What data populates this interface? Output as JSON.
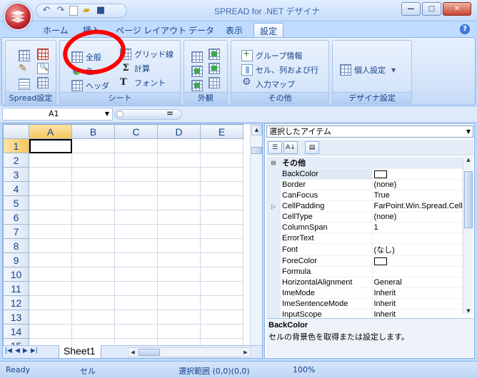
{
  "window": {
    "title": "SPREAD for .NET デザイナ",
    "minimize_label": "—",
    "maximize_label": "□",
    "close_label": "✕",
    "help_label": "?"
  },
  "tabs": [
    {
      "label": "ホーム"
    },
    {
      "label": "挿入"
    },
    {
      "label": "ページ レイアウト"
    },
    {
      "label": "データ"
    },
    {
      "label": "表示"
    },
    {
      "label": "設定"
    }
  ],
  "ribbon": {
    "groups": {
      "spread": {
        "label": "Spread設定"
      },
      "sheet": {
        "label": "シート",
        "items": {
          "general": "全般",
          "color": "色",
          "header": "ヘッダ",
          "gridlines": "グリッド線",
          "calc": "計算",
          "font": "フォント"
        }
      },
      "appearance": {
        "label": "外観"
      },
      "other": {
        "label": "その他",
        "items": {
          "group_info": "グループ情報",
          "cell_colrow": "セル、列および行",
          "input_map": "入力マップ"
        }
      },
      "designer": {
        "label": "デザイナ設定",
        "items": {
          "personal": "個人設定"
        }
      }
    }
  },
  "formula_bar": {
    "name_box": "A1",
    "equals": "="
  },
  "sheet": {
    "columns": [
      "A",
      "B",
      "C",
      "D",
      "E"
    ],
    "rows": [
      "1",
      "2",
      "3",
      "4",
      "5",
      "6",
      "7",
      "8",
      "9",
      "10",
      "11",
      "12",
      "13",
      "14",
      "15"
    ],
    "tab_name": "Sheet1"
  },
  "property_grid": {
    "selector": "選択したアイテム",
    "category": "その他",
    "properties": [
      {
        "name": "BackColor",
        "value": ""
      },
      {
        "name": "Border",
        "value": "(none)"
      },
      {
        "name": "CanFocus",
        "value": "True"
      },
      {
        "name": "CellPadding",
        "value": "FarPoint.Win.Spread.CellPa"
      },
      {
        "name": "CellType",
        "value": "(none)"
      },
      {
        "name": "ColumnSpan",
        "value": "1"
      },
      {
        "name": "ErrorText",
        "value": ""
      },
      {
        "name": "Font",
        "value": "(なし)"
      },
      {
        "name": "ForeColor",
        "value": ""
      },
      {
        "name": "Formula",
        "value": ""
      },
      {
        "name": "HorizontalAlignment",
        "value": "General"
      },
      {
        "name": "ImeMode",
        "value": "Inherit"
      },
      {
        "name": "ImeSentenceMode",
        "value": "Inherit"
      },
      {
        "name": "InputScope",
        "value": "Inherit"
      }
    ],
    "description_title": "BackColor",
    "description_text": "セルの背景色を取得または設定します。"
  },
  "status": {
    "ready": "Ready",
    "cell": "セル",
    "range": "選択範囲 (0,0)(0,0)",
    "zoom": "100%"
  },
  "colors": {
    "accent": "#15428b",
    "annotation": "#ff0000"
  }
}
